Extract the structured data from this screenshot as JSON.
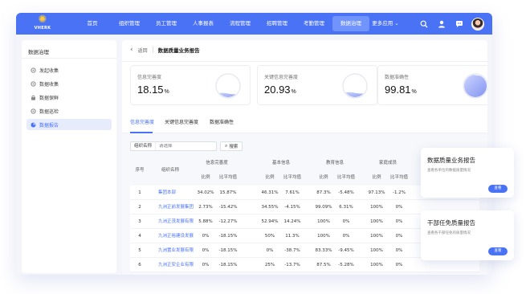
{
  "brand": {
    "logo_text": "VHERK"
  },
  "nav": {
    "items": [
      "首页",
      "组织管理",
      "员工管理",
      "人事报表",
      "流程管理",
      "招聘管理",
      "考勤管理",
      "数据治理",
      "更多应用"
    ],
    "active_index": 7,
    "icons": [
      "search-icon",
      "user-icon",
      "chat-icon"
    ]
  },
  "sidebar": {
    "title": "数据治理",
    "items": [
      {
        "label": "发起收集",
        "icon": "gear-icon"
      },
      {
        "label": "数据收集",
        "icon": "gear-icon"
      },
      {
        "label": "数据保鲜",
        "icon": "lock-icon"
      },
      {
        "label": "数据巡检",
        "icon": "gear-icon"
      },
      {
        "label": "数据报告",
        "icon": "chart-icon"
      }
    ],
    "active_index": 4
  },
  "header": {
    "back_label": "返回",
    "title": "数据质量业务报告"
  },
  "cards": [
    {
      "label": "信息完善度",
      "value": "18.15",
      "unit": "%",
      "fill": 0.18
    },
    {
      "label": "关键信息完善度",
      "value": "20.93",
      "unit": "%",
      "fill": 0.21
    },
    {
      "label": "数据准确性",
      "value": "99.81",
      "unit": "%",
      "fill": 0.998
    }
  ],
  "tabs": [
    "信息完善度",
    "关键信息完善度",
    "数据准确性"
  ],
  "filter": {
    "label": "组织名称",
    "placeholder": "请选择",
    "search_label": "搜索"
  },
  "table": {
    "col_index": "序号",
    "col_org": "组织名称",
    "groups": [
      "信息完善度",
      "基本信息",
      "教育信息",
      "家庭成员"
    ],
    "sub_cols": [
      "比例",
      "比平均值"
    ],
    "rows": [
      {
        "index": "1",
        "org": "集团本部",
        "vals": [
          "34.02%",
          "15.87%",
          "46.31%",
          "7.61%",
          "87.3%",
          "-5.48%",
          "97.13%",
          "-1.2%"
        ]
      },
      {
        "index": "2",
        "org": "九洲正前发展集团",
        "vals": [
          "2.73%",
          "-15.42%",
          "34.55%",
          "-4.15%",
          "99.09%",
          "6.31%",
          "100%",
          "0%"
        ]
      },
      {
        "index": "3",
        "org": "九洲正茂发展有限",
        "vals": [
          "5.88%",
          "-12.27%",
          "52.94%",
          "14.24%",
          "100%",
          "0%",
          "100%",
          "0%"
        ]
      },
      {
        "index": "4",
        "org": "九洲正裕建设发展",
        "vals": [
          "0%",
          "-18.15%",
          "50%",
          "11.3%",
          "100%",
          "0%",
          "100%",
          "0%"
        ]
      },
      {
        "index": "5",
        "org": "九洲置业发展有限",
        "vals": [
          "0%",
          "-18.15%",
          "0%",
          "-38.7%",
          "83.33%",
          "-9.45%",
          "100%",
          "0%"
        ]
      },
      {
        "index": "6",
        "org": "九洲正安企业有限",
        "vals": [
          "0%",
          "-18.15%",
          "25%",
          "-13.7%",
          "87.5%",
          "-5.28%",
          "100%",
          "0%"
        ]
      }
    ]
  },
  "float_cards": [
    {
      "title": "数据质量业务报告",
      "desc": "查看各单位的数据质量情况",
      "button": "查看"
    },
    {
      "title": "干部任免质量报告",
      "desc": "查看各干部任免的质量情况",
      "button": "查看"
    }
  ],
  "colors": {
    "primary": "#4a72f5",
    "nav_bg": "#4a72f5",
    "accent_light": "#e6ecfc"
  }
}
